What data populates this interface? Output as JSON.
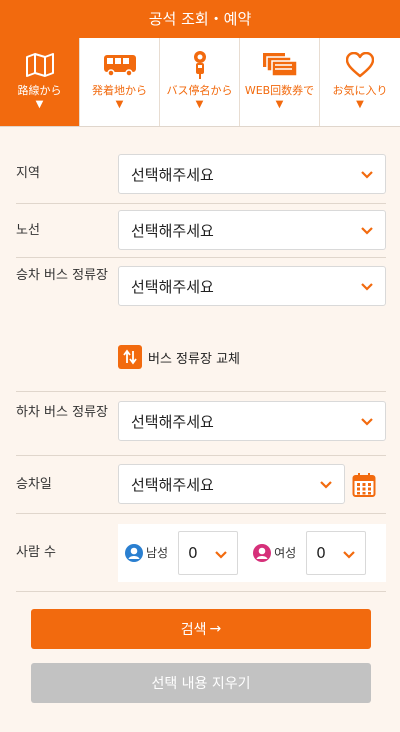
{
  "header": {
    "title": "공석 조회・예약"
  },
  "tabs": [
    {
      "label": "路線から",
      "icon": "map-icon",
      "active": true
    },
    {
      "label": "発着地から",
      "icon": "bus-icon",
      "active": false
    },
    {
      "label": "バス停名から",
      "icon": "bus-stop-icon",
      "active": false
    },
    {
      "label": "WEB回数券で",
      "icon": "tickets-icon",
      "active": false
    },
    {
      "label": "お気に入り",
      "icon": "heart-icon",
      "active": false
    }
  ],
  "tab_arrow": "▼",
  "form": {
    "region": {
      "label": "지역",
      "value": "선택해주세요"
    },
    "route": {
      "label": "노선",
      "value": "선택해주세요"
    },
    "boarding": {
      "label": "승차 버스 정류장",
      "value": "선택해주세요"
    },
    "swap": {
      "label": "버스 정류장 교체"
    },
    "alighting": {
      "label": "하차 버스 정류장",
      "value": "선택해주세요"
    },
    "date": {
      "label": "승차일",
      "value": "선택해주세요"
    },
    "people": {
      "label": "사람 수",
      "male": {
        "label": "남성",
        "value": "0"
      },
      "female": {
        "label": "여성",
        "value": "0"
      }
    }
  },
  "buttons": {
    "search": "검색",
    "search_arrow": "→",
    "clear": "선택 내용 지우기"
  },
  "colors": {
    "accent": "#f26a0e",
    "male": "#2a7fd0",
    "female": "#d6307a",
    "disabled": "#c2c2c2"
  }
}
